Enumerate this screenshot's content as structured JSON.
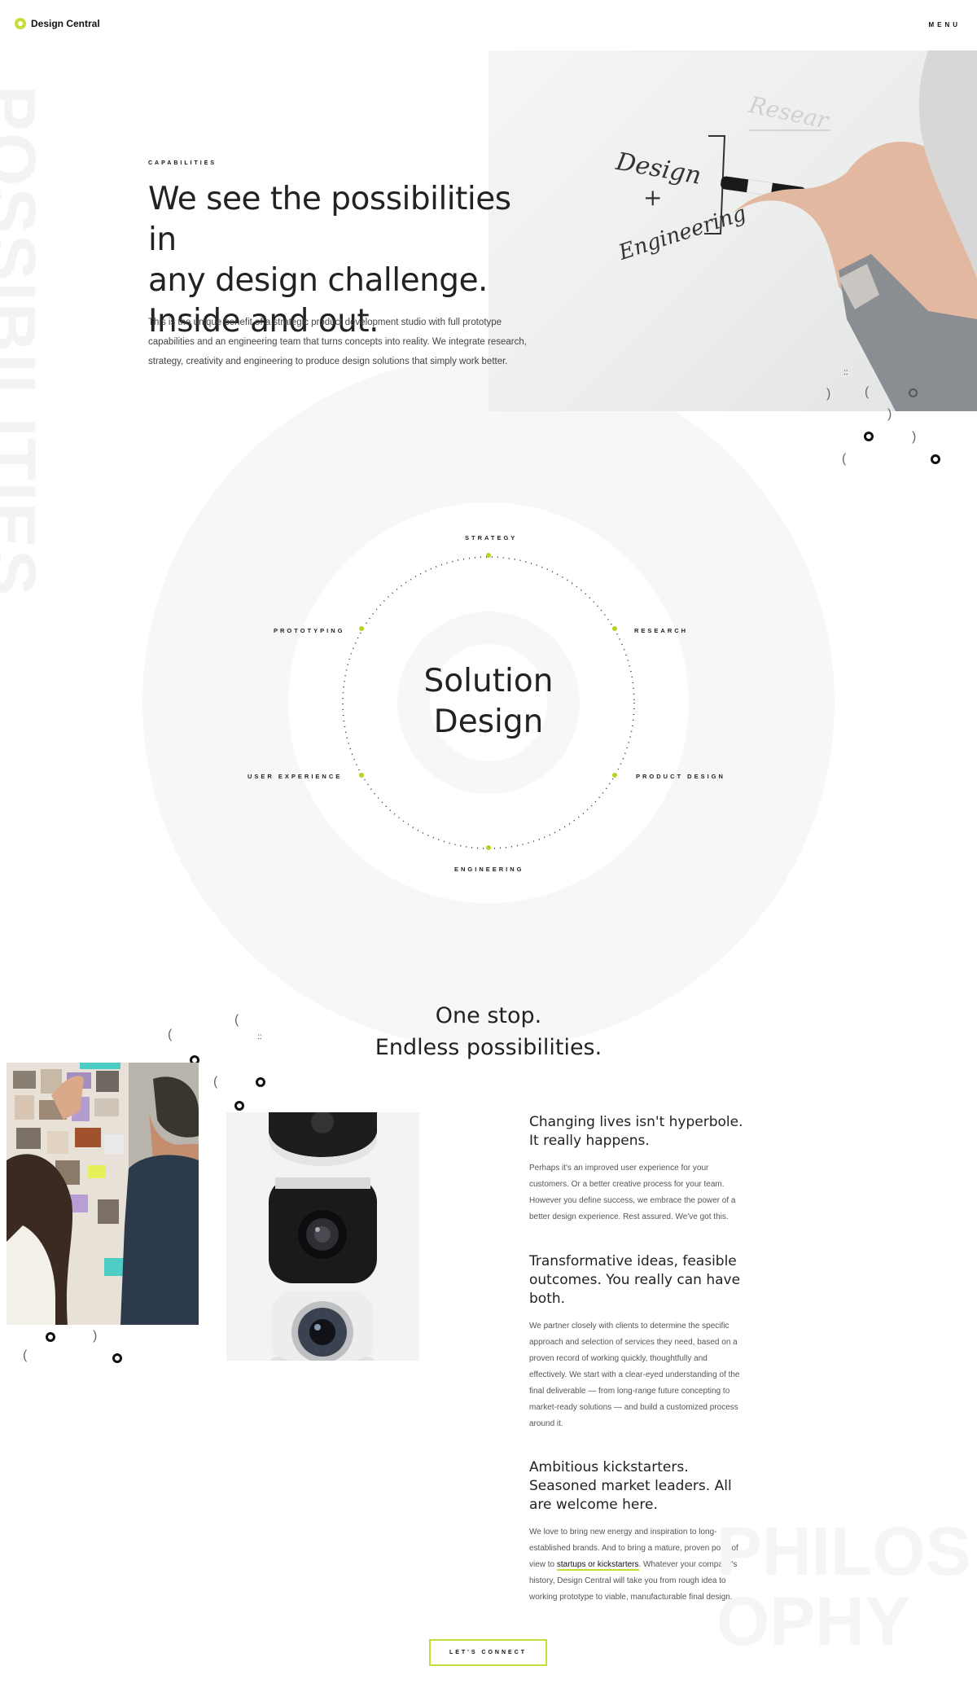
{
  "header": {
    "logo_text": "Design Central",
    "menu_label": "MENU"
  },
  "watermark_vertical": "POSSIBILITIES",
  "hero": {
    "eyebrow": "CAPABILITIES",
    "title_line1": "We see the possibilities in",
    "title_line2": "any design challenge.",
    "title_line3": "Inside and out.",
    "body": "This is the unique benefit of a strategic product development studio with full prototype capabilities and an engineering team that turns concepts into reality. We integrate research, strategy, creativity and engineering to produce design solutions that simply work better.",
    "whiteboard_text_1": "Design",
    "whiteboard_text_2": "+",
    "whiteboard_text_3": "Engineering"
  },
  "capabilities_wheel": {
    "center_line1": "Solution",
    "center_line2": "Design",
    "labels": {
      "strategy": "STRATEGY",
      "research": "RESEARCH",
      "product_design": "PRODUCT DESIGN",
      "engineering": "ENGINEERING",
      "user_experience": "USER EXPERIENCE",
      "prototyping": "PROTOTYPING"
    },
    "accent_color": "#b5d321"
  },
  "section2": {
    "title_line1": "One stop.",
    "title_line2": "Endless possibilities."
  },
  "features": [
    {
      "heading": "Changing lives isn't hyperbole. It really happens.",
      "body": "Perhaps it's an improved user experience for your customers. Or a better creative process for your team. However you define success, we embrace the power of a better design experience. Rest assured. We've got this."
    },
    {
      "heading": "Transformative ideas, feasible outcomes. You really can have both.",
      "body": "We partner closely with clients to determine the specific approach and selection of services they need, based on a proven record of working quickly, thoughtfully and effectively. We start with a clear-eyed understanding of the final deliverable — from long-range future concepting to market-ready solutions — and build a customized process around it."
    },
    {
      "heading": "Ambitious kickstarters. Seasoned market leaders. All are welcome here.",
      "body_before_link": "We love to bring new energy and inspiration to long-established brands. And to bring a mature, proven point of view to ",
      "link_text": "startups or kickstarters",
      "body_after_link": ". Whatever your company's history, Design Central will take you from rough idea to working prototype to viable, manufacturable final design."
    }
  ],
  "watermark_horizontal": "PHILOS\nOPHY",
  "cta_label": "LET'S CONNECT",
  "colors": {
    "accent": "#c5dc3a",
    "text": "#222222",
    "watermark": "#f3f3f3"
  }
}
